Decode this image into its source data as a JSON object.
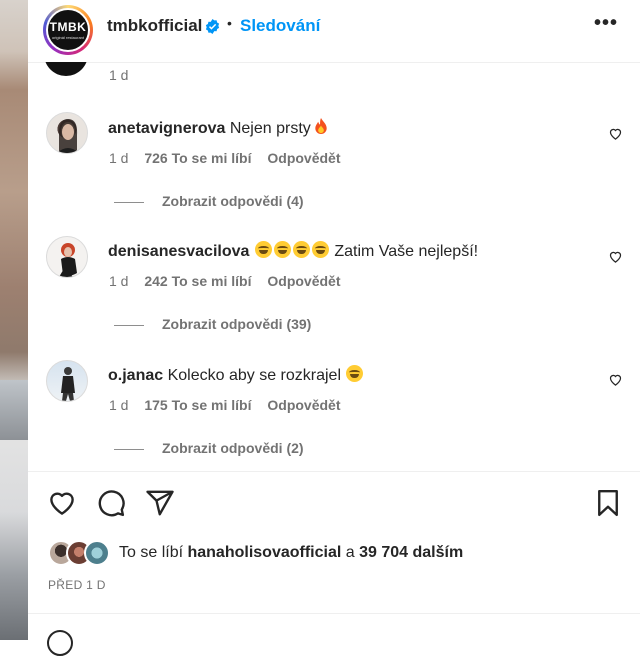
{
  "header": {
    "logo_text": "TMBK",
    "logo_subtext": "originál restaurant",
    "username": "tmbkofficial",
    "separator": "•",
    "follow_label": "Sledování",
    "more_label": "•••"
  },
  "previous_comment": {
    "time": "1 d"
  },
  "comments": [
    {
      "username": "anetavignerova",
      "text": "Nejen prsty",
      "emoji": "fire",
      "time": "1 d",
      "likes": "726 To se mi líbí",
      "reply_label": "Odpovědět",
      "view_replies": "Zobrazit odpovědi (4)"
    },
    {
      "username": "denisanesvacilova",
      "text": "Zatim Vaše nejlepší!",
      "emoji": "laugh x4",
      "time": "1 d",
      "likes": "242 To se mi líbí",
      "reply_label": "Odpovědět",
      "view_replies": "Zobrazit odpovědi (39)"
    },
    {
      "username": "o.janac",
      "text": "Kolecko aby se rozkrajel",
      "emoji": "laugh",
      "time": "1 d",
      "likes": "175 To se mi líbí",
      "reply_label": "Odpovědět",
      "view_replies": "Zobrazit odpovědi (2)"
    }
  ],
  "actions": {
    "like_icon": "heart-icon",
    "comment_icon": "comment-icon",
    "share_icon": "share-icon",
    "save_icon": "bookmark-icon"
  },
  "likes": {
    "prefix": "To se líbí",
    "user": "hanaholisovaofficial",
    "connector": "a",
    "others": "39 704 dalším"
  },
  "posted": "PŘED 1 D",
  "colors": {
    "accent": "#0095f6",
    "secondary_text": "#737373",
    "primary_text": "#262626"
  }
}
